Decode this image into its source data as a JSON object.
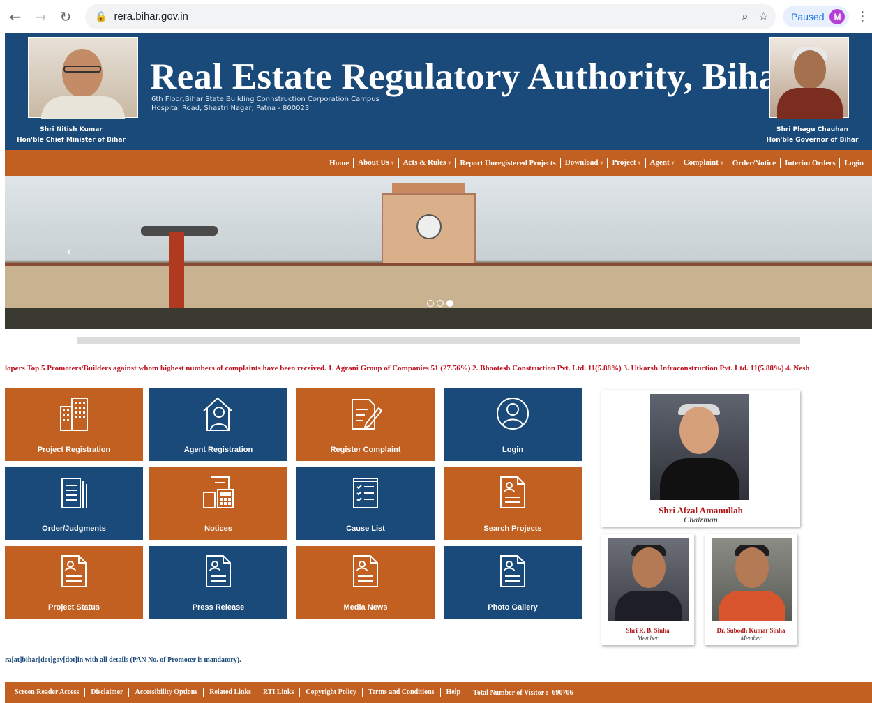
{
  "browser": {
    "url": "rera.bihar.gov.in",
    "profile_status": "Paused",
    "profile_initial": "M",
    "icons": [
      "back-arrow-icon",
      "forward-arrow-icon",
      "reload-icon",
      "lock-icon",
      "zoom-icon",
      "star-icon",
      "menu-kebab-icon"
    ]
  },
  "header": {
    "title": "Real Estate Regulatory Authority, Bihar",
    "address_line1": "6th Floor,Bihar State Building Connstruction Corporation Campus",
    "address_line2": "Hospital Road, Shastri Nagar, Patna - 800023",
    "left_person": {
      "name": "Shri Nitish Kumar",
      "role": "Hon'ble Chief Minister of Bihar"
    },
    "right_person": {
      "name": "Shri Phagu Chauhan",
      "role": "Hon'ble Governor of Bihar"
    }
  },
  "nav": {
    "items": [
      {
        "label": "Home",
        "dropdown": false
      },
      {
        "label": "About Us",
        "dropdown": true
      },
      {
        "label": "Acts & Rules",
        "dropdown": true
      },
      {
        "label": "Report Unregistered Projects",
        "dropdown": false
      },
      {
        "label": "Download",
        "dropdown": true
      },
      {
        "label": "Project",
        "dropdown": true
      },
      {
        "label": "Agent",
        "dropdown": true
      },
      {
        "label": "Complaint",
        "dropdown": true
      },
      {
        "label": "Order/Notice",
        "dropdown": false
      },
      {
        "label": "Interim Orders",
        "dropdown": false
      },
      {
        "label": "Login",
        "dropdown": false
      }
    ]
  },
  "slider": {
    "active_slide": 3,
    "slide_count": 3
  },
  "marquee": "lopers Top 5 Promoters/Builders against whom highest numbers of complaints have been received. 1. Agrani Group of Companies 51 (27.56%) 2. Bhootesh Construction Pvt. Ltd. 11(5.88%) 3. Utkarsh Infraconstruction Pvt. Ltd. 11(5.88%) 4. Nesh",
  "tiles": [
    {
      "label": "Project Registration",
      "icon": "building-icon",
      "color": "orange"
    },
    {
      "label": "Agent Registration",
      "icon": "agent-house-icon",
      "color": "blue"
    },
    {
      "label": "Register Complaint",
      "icon": "document-pen-icon",
      "color": "orange"
    },
    {
      "label": "Login",
      "icon": "user-circle-icon",
      "color": "blue"
    },
    {
      "label": "Order/Judgments",
      "icon": "documents-icon",
      "color": "blue"
    },
    {
      "label": "Notices",
      "icon": "notice-calculator-icon",
      "color": "orange"
    },
    {
      "label": "Cause List",
      "icon": "checklist-icon",
      "color": "blue"
    },
    {
      "label": "Search Projects",
      "icon": "profile-document-icon",
      "color": "orange"
    },
    {
      "label": "Project Status",
      "icon": "profile-document-icon",
      "color": "orange"
    },
    {
      "label": "Press Release",
      "icon": "profile-document-icon",
      "color": "blue"
    },
    {
      "label": "Media News",
      "icon": "profile-document-icon",
      "color": "orange"
    },
    {
      "label": "Photo Gallery",
      "icon": "profile-document-icon",
      "color": "blue"
    }
  ],
  "chairman": {
    "name": "Shri Afzal Amanullah",
    "role": "Chairman"
  },
  "members": [
    {
      "name": "Shri R. B. Sinha",
      "role": "Member"
    },
    {
      "name": "Dr. Subodh Kumar Sinha",
      "role": "Member"
    }
  ],
  "notice_line": "ra[at]bihar[dot]gov[dot]in with all details (PAN No. of Promoter is mandatory).",
  "footer": {
    "links": [
      "Screen Reader Access",
      "Disclaimer",
      "Accessibility Options",
      "Related Links",
      "RTI Links",
      "Copyright Policy",
      "Terms and Conditions",
      "Help"
    ],
    "visitor_text": "Total Number of Visitor :- 690706"
  },
  "colors": {
    "primary_blue": "#1a4a7a",
    "accent_orange": "#c16020",
    "marquee_red": "#c0121f"
  }
}
